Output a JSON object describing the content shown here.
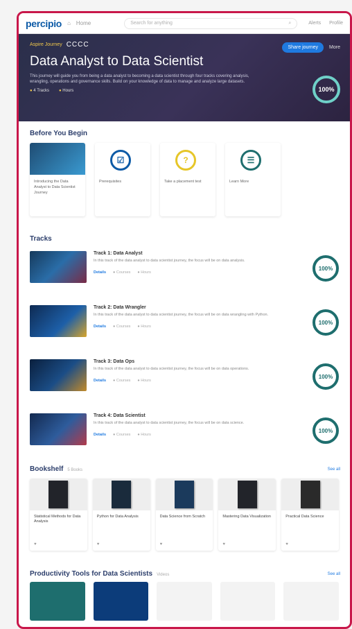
{
  "nav": {
    "logo": "percipio",
    "home": "Home",
    "search_placeholder": "Search for anything",
    "search_icon": "search-icon",
    "bell": "Alerts",
    "user": "Profile"
  },
  "hero": {
    "label": "Aspire Journey",
    "code": "CCCC",
    "title": "Data Analyst to Data Scientist",
    "description": "This journey will guide you from being a data analyst to becoming a data scientist through four tracks covering analysis, wrangling, operations and governance skills. Build on your knowledge of data to manage and analyze large datasets.",
    "meta_tracks": "4 Tracks",
    "meta_hours": "Hours",
    "cta": "Share journey",
    "more": "More",
    "progress": "100%",
    "colors": {
      "bg": "#2a2f4a",
      "accent": "#f2c94c",
      "ring": "#6fd0c8"
    }
  },
  "before_you_begin": {
    "title": "Before You Begin",
    "cards": [
      {
        "icon": "video-thumbnail",
        "label": "Introducing the Data Analyst to Data Scientist Journey"
      },
      {
        "icon": "checkbox-icon",
        "label": "Prerequisites"
      },
      {
        "icon": "question-icon",
        "label": "Take a placement test"
      },
      {
        "icon": "list-icon",
        "label": "Learn More"
      }
    ]
  },
  "tracks": {
    "title": "Tracks",
    "items": [
      {
        "title": "Track 1: Data Analyst",
        "desc": "In this track of the data analyst to data scientist journey, the focus will be on data analysis.",
        "link": "Details",
        "courses": "Courses",
        "hours": "Hours",
        "progress": "100%"
      },
      {
        "title": "Track 2: Data Wrangler",
        "desc": "In this track of the data analyst to data scientist journey, the focus will be on data wrangling with Python.",
        "link": "Details",
        "courses": "Courses",
        "hours": "Hours",
        "progress": "100%"
      },
      {
        "title": "Track 3: Data Ops",
        "desc": "In this track of the data analyst to data scientist journey, the focus will be on data operations.",
        "link": "Details",
        "courses": "Courses",
        "hours": "Hours",
        "progress": "100%"
      },
      {
        "title": "Track 4: Data Scientist",
        "desc": "In this track of the data analyst to data scientist journey, the focus will be on data science.",
        "link": "Details",
        "courses": "Courses",
        "hours": "Hours",
        "progress": "100%"
      }
    ]
  },
  "bookshelf": {
    "title": "Bookshelf",
    "count": "5 Books",
    "see_all": "See all",
    "books": [
      {
        "title": "Statistical Methods for Data Analysis",
        "foot": "♥"
      },
      {
        "title": "Python for Data Analysis",
        "foot": "♥"
      },
      {
        "title": "Data Science from Scratch",
        "foot": "♥"
      },
      {
        "title": "Mastering Data Visualization",
        "foot": "♥"
      },
      {
        "title": "Practical Data Science",
        "foot": "♥"
      }
    ]
  },
  "productivity": {
    "title": "Productivity Tools for Data Scientists",
    "count": "Videos",
    "see_all": "See all",
    "cards": [
      {
        "color": "#1e6e6e"
      },
      {
        "color": "#0c3c7a"
      },
      {
        "color": "#f3f3f3"
      },
      {
        "color": "#f3f3f3"
      },
      {
        "color": "#f3f3f3"
      }
    ]
  }
}
